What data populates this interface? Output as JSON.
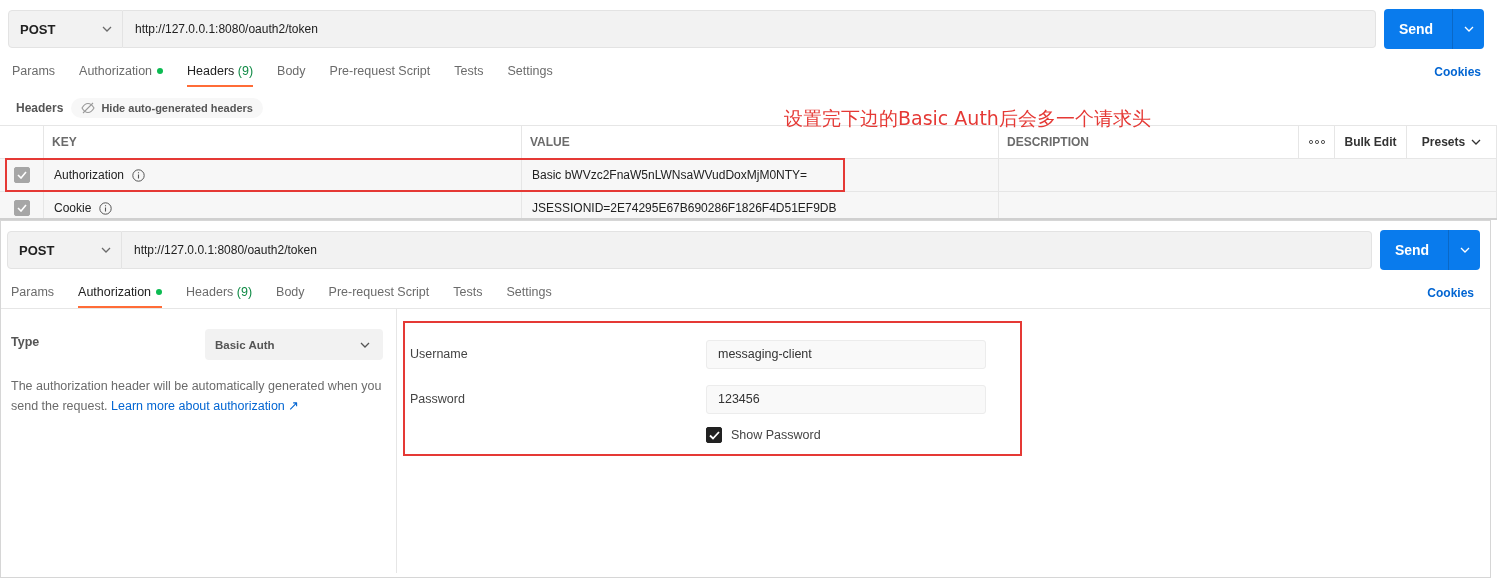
{
  "panels": [
    {
      "kind": "headers",
      "request": {
        "method": "POST",
        "url": "http://127.0.0.1:8080/oauth2/token",
        "send": "Send"
      },
      "tabs": [
        {
          "label": "Params",
          "selected": false
        },
        {
          "label": "Authorization",
          "selected": false,
          "status_dot": true
        },
        {
          "label": "Headers",
          "count": "(9)",
          "selected": true
        },
        {
          "label": "Body",
          "selected": false
        },
        {
          "label": "Pre-request Script",
          "selected": false
        },
        {
          "label": "Tests",
          "selected": false
        },
        {
          "label": "Settings",
          "selected": false
        }
      ],
      "cookies": "Cookies",
      "toolbar": {
        "label": "Headers",
        "toggle": "Hide auto-generated headers"
      },
      "annotation": "设置完下边的Basic Auth后会多一个请求头",
      "columns": [
        "KEY",
        "VALUE",
        "DESCRIPTION"
      ],
      "actions": {
        "bulk_edit": "Bulk Edit",
        "presets": "Presets"
      },
      "rows": [
        {
          "checked": true,
          "key": "Authorization",
          "value": "Basic bWVzc2FnaW5nLWNsaWVudDoxMjM0NTY=",
          "highlighted": true
        },
        {
          "checked": true,
          "key": "Cookie",
          "value": "JSESSIONID=2E74295E67B690286F1826F4D51EF9DB",
          "highlighted": false
        }
      ]
    },
    {
      "kind": "auth",
      "request": {
        "method": "POST",
        "url": "http://127.0.0.1:8080/oauth2/token",
        "send": "Send"
      },
      "tabs": [
        {
          "label": "Params",
          "selected": false
        },
        {
          "label": "Authorization",
          "selected": true,
          "status_dot": true
        },
        {
          "label": "Headers",
          "count": "(9)",
          "selected": false
        },
        {
          "label": "Body",
          "selected": false
        },
        {
          "label": "Pre-request Script",
          "selected": false
        },
        {
          "label": "Tests",
          "selected": false
        },
        {
          "label": "Settings",
          "selected": false
        }
      ],
      "cookies": "Cookies",
      "type_label": "Type",
      "type_value": "Basic Auth",
      "help": "The authorization header will be automatically generated when you send the request.",
      "help_link": "Learn more about authorization ↗",
      "fields": [
        {
          "label": "Username",
          "value": "messaging-client"
        },
        {
          "label": "Password",
          "value": "123456"
        }
      ],
      "show_password": {
        "label": "Show Password",
        "checked": true
      },
      "highlighted": true
    }
  ]
}
